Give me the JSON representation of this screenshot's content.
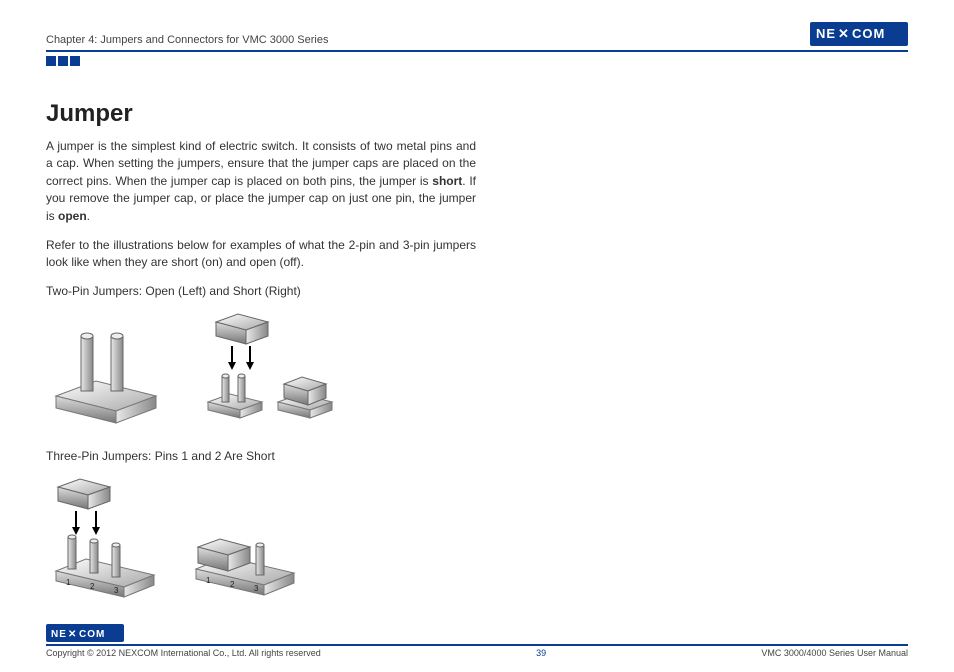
{
  "header": {
    "chapter": "Chapter 4: Jumpers and Connectors for VMC 3000 Series",
    "brand": "NE COM"
  },
  "main": {
    "heading": "Jumper",
    "para1_a": "A jumper is the simplest kind of electric switch. It consists of two metal pins and a cap. When setting the jumpers, ensure that the jumper caps are placed on the correct pins. When the jumper cap is placed on both pins, the jumper is ",
    "para1_b": "short",
    "para1_c": ". If you remove the jumper cap, or place the jumper cap on just one pin, the jumper is ",
    "para1_d": "open",
    "para1_e": ".",
    "para2": "Refer to the illustrations below for examples of what the 2-pin and 3-pin jumpers look like when they are short (on) and open (off).",
    "caption1": "Two-Pin Jumpers: Open (Left) and Short (Right)",
    "caption2": "Three-Pin Jumpers: Pins 1 and 2 Are Short"
  },
  "footer": {
    "brand": "NE COM",
    "copyright": "Copyright © 2012 NEXCOM International Co., Ltd. All rights reserved",
    "page": "39",
    "doc": "VMC 3000/4000 Series User Manual"
  },
  "pins": {
    "p1": "1",
    "p2": "2",
    "p3": "3"
  }
}
